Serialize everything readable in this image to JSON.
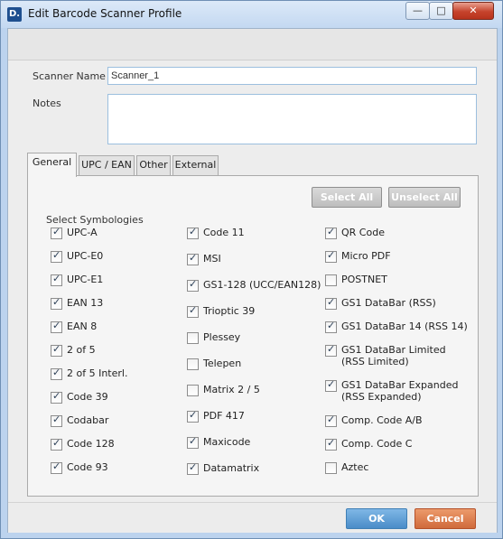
{
  "window": {
    "title": "Edit Barcode Scanner Profile",
    "icon_letter": "D.",
    "min_glyph": "—",
    "max_glyph": "□",
    "close_glyph": "✕"
  },
  "form": {
    "scanner_name_label": "Scanner Name",
    "scanner_name_value": "Scanner_1",
    "notes_label": "Notes",
    "notes_value": ""
  },
  "tabs": [
    {
      "label": "General",
      "active": true
    },
    {
      "label": "UPC / EAN",
      "active": false
    },
    {
      "label": "Other",
      "active": false
    },
    {
      "label": "External",
      "active": false
    }
  ],
  "general": {
    "select_all_label": "Select All",
    "unselect_all_label": "Unselect All",
    "heading": "Select Symbologies",
    "check_glyph": "✓",
    "columns": [
      [
        {
          "label": "UPC-A",
          "checked": true
        },
        {
          "label": "UPC-E0",
          "checked": true
        },
        {
          "label": "UPC-E1",
          "checked": true
        },
        {
          "label": "EAN 13",
          "checked": true
        },
        {
          "label": "EAN 8",
          "checked": true
        },
        {
          "label": "2 of 5",
          "checked": true
        },
        {
          "label": "2 of 5 Interl.",
          "checked": true
        },
        {
          "label": "Code 39",
          "checked": true
        },
        {
          "label": "Codabar",
          "checked": true
        },
        {
          "label": "Code 128",
          "checked": true
        },
        {
          "label": "Code 93",
          "checked": true
        }
      ],
      [
        {
          "label": "Code 11",
          "checked": true
        },
        {
          "label": "MSI",
          "checked": true
        },
        {
          "label": "GS1-128 (UCC/EAN128)",
          "checked": true
        },
        {
          "label": "Trioptic 39",
          "checked": true
        },
        {
          "label": "Plessey",
          "checked": false
        },
        {
          "label": "Telepen",
          "checked": false
        },
        {
          "label": "Matrix 2 / 5",
          "checked": false
        },
        {
          "label": "PDF 417",
          "checked": true
        },
        {
          "label": "Maxicode",
          "checked": true
        },
        {
          "label": "Datamatrix",
          "checked": true
        }
      ],
      [
        {
          "label": "QR Code",
          "checked": true
        },
        {
          "label": "Micro PDF",
          "checked": true
        },
        {
          "label": "POSTNET",
          "checked": false
        },
        {
          "label": "GS1 DataBar (RSS)",
          "checked": true
        },
        {
          "label": "GS1 DataBar 14 (RSS 14)",
          "checked": true
        },
        {
          "label": "GS1 DataBar Limited",
          "label2": "(RSS Limited)",
          "checked": true
        },
        {
          "label": "GS1 DataBar Expanded",
          "label2": "(RSS Expanded)",
          "checked": true
        },
        {
          "label": "Comp. Code A/B",
          "checked": true
        },
        {
          "label": "Comp. Code C",
          "checked": true
        },
        {
          "label": "Aztec",
          "checked": false
        }
      ]
    ]
  },
  "footer": {
    "ok_label": "OK",
    "cancel_label": "Cancel"
  },
  "colors": {
    "ok": "#4a8cc8",
    "cancel": "#d06a3b",
    "disabled_button": "#c8c8c8"
  }
}
